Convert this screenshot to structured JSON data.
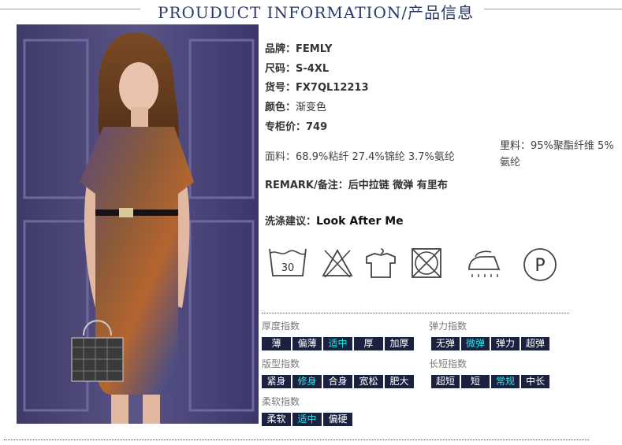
{
  "header": {
    "title": "PROUDUCT INFORMATION/产品信息"
  },
  "product": {
    "brand_label": "品牌：",
    "brand": "FEMLY",
    "size_label": "尺码：",
    "size": "S-4XL",
    "sku_label": "货号：",
    "sku": "FX7QL12213",
    "color_label": "颜色：",
    "color": "渐变色",
    "price_label": "专柜价：",
    "price": "749",
    "fabric_label": "面料：",
    "fabric": "68.9%粘纤 27.4%锦纶 3.7%氨纶",
    "lining_label": "里料：",
    "lining": "95%聚酯纤维 5%氨纶",
    "remark_label": "REMARK/备注：",
    "remark": "后中拉链 微弹 有里布",
    "wash_label": "洗涤建议：",
    "wash": "Look After Me"
  },
  "care_icons": [
    {
      "icon": "wash-30-icon",
      "text": "30"
    },
    {
      "icon": "no-bleach-icon"
    },
    {
      "icon": "hang-dry-icon"
    },
    {
      "icon": "no-tumble-dry-icon"
    },
    {
      "icon": "low-iron-icon"
    },
    {
      "icon": "dry-clean-p-icon",
      "text": "P"
    }
  ],
  "indices": {
    "thickness": {
      "title": "厚度指数",
      "options": [
        "薄",
        "偏薄",
        "适中",
        "厚",
        "加厚"
      ],
      "selected": 2
    },
    "elasticity": {
      "title": "弹力指数",
      "options": [
        "无弹",
        "微弹",
        "弹力",
        "超弹"
      ],
      "selected": 1
    },
    "fit": {
      "title": "版型指数",
      "options": [
        "紧身",
        "修身",
        "合身",
        "宽松",
        "肥大"
      ],
      "selected": 1
    },
    "length": {
      "title": "长短指数",
      "options": [
        "超短",
        "短",
        "常规",
        "中长"
      ],
      "selected": 2
    },
    "softness": {
      "title": "柔软指数",
      "options": [
        "柔软",
        "适中",
        "偏硬"
      ],
      "selected": 1
    }
  },
  "colors": {
    "tag_bg": "#1b2240",
    "tag_selected_text": "#27e7ea",
    "title": "#2c3a6b"
  }
}
